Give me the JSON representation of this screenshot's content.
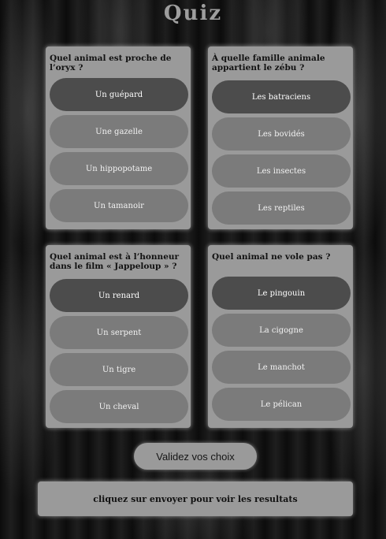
{
  "page": {
    "title": "Quiz"
  },
  "questions": [
    {
      "text": "Quel animal est proche de l’oryx ?",
      "answers": [
        "Un guépard",
        "Une gazelle",
        "Un hippopotame",
        "Un tamanoir"
      ],
      "selected": "Un guépard"
    },
    {
      "text": "À quelle famille animale appartient le zébu ?",
      "answers": [
        "Les batraciens",
        "Les bovidés",
        "Les insectes",
        "Les reptiles"
      ],
      "selected": "Les batraciens"
    },
    {
      "text": "Quel animal est à l’honneur dans le film « Jappeloup » ?",
      "answers": [
        "Un renard",
        "Un serpent",
        "Un tigre",
        "Un cheval"
      ],
      "selected": "Un renard"
    },
    {
      "text": "Quel animal ne vole pas ?",
      "answers": [
        "Le pingouin",
        "La cigogne",
        "Le manchot",
        "Le pélican"
      ],
      "selected": "Le pingouin"
    }
  ],
  "actions": {
    "validate_label": "Validez vos choix"
  },
  "result": {
    "message": "cliquez sur envoyer pour voir les resultats"
  },
  "colors": {
    "card": "#9a9a9a",
    "answer": "#7b7b7b",
    "answer_selected": "#4c4c4c",
    "title": "#9e9e9e"
  }
}
